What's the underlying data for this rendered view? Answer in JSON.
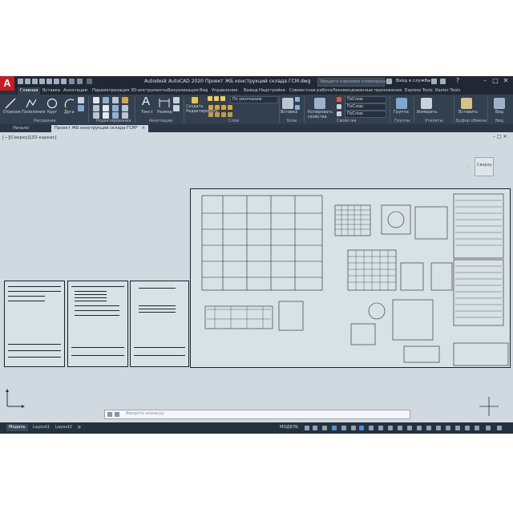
{
  "app": {
    "logo": "A",
    "title": "Autodesk AutoCAD 2020  Проект ЖБ конструкций склада ГСМ.dwg",
    "search_placeholder": "Введите ключевое слово/фразу",
    "signin": "Вход в службы",
    "help": "?"
  },
  "ribbon_tabs": [
    "Главная",
    "Вставка",
    "Аннотации",
    "Параметризация",
    "3D-инструменты",
    "Визуализация",
    "Вид",
    "Управление",
    "Вывод",
    "Надстройки",
    "Совместная работа",
    "Рекомендованные приложения",
    "Express Tools",
    "Raster Tools"
  ],
  "ribbon": {
    "draw_tools": [
      "Отрезок",
      "Полилиния",
      "Круг",
      "Дуга"
    ],
    "text": "Текст",
    "dimension": "Размер",
    "table_tools": [
      "Создать",
      "Редактировать"
    ],
    "insert": "Вставка",
    "match_properties": "Копировать свойства",
    "layer_combo": "По умолчанию",
    "color_combo": "ПоСлою",
    "linetype_combo": "ПоСлою",
    "lineweight_combo": "ПоСлою",
    "group": "Группа",
    "measure": "Измерить",
    "paste": "Вставить",
    "base": "Вид",
    "panels": [
      "Рисование",
      "Редактирование",
      "Аннотации",
      "Слои",
      "Блок",
      "Свойства",
      "Группы",
      "Утилиты",
      "Буфер обмена",
      "Вид"
    ]
  },
  "file_tabs": {
    "start": "Начало",
    "document": "Проект ЖБ конструкций склада ГСМ*",
    "close": "×",
    "new": "+"
  },
  "viewport_label": "[−][Сверху][2D-каркас]",
  "viewcube_label": "Сверху",
  "command_placeholder": "Введите команду",
  "status_tabs": [
    "Модель",
    "Layout1",
    "Layout2"
  ],
  "status_model": "МОДЕЛЬ",
  "colors": {
    "ribbon_bg": "#33404f",
    "titlebar_bg": "#1f2833",
    "canvas_bg": "#cfd9df",
    "logo_red": "#c71d22"
  }
}
